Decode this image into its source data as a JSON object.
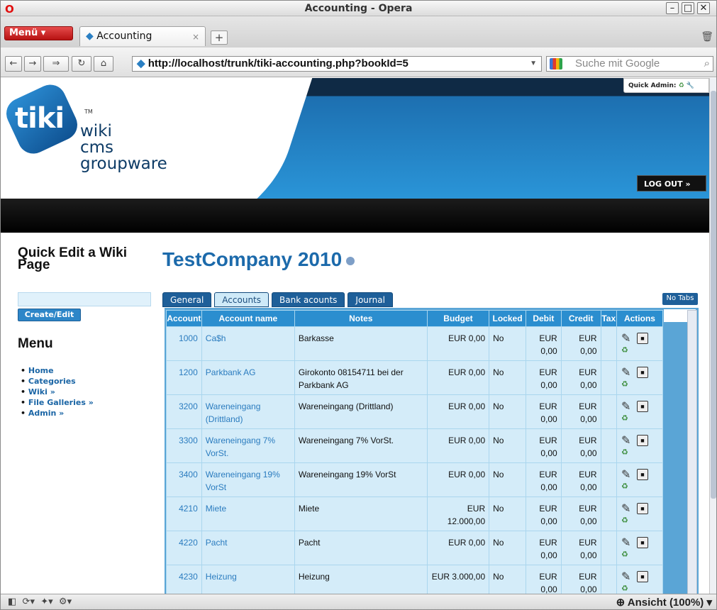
{
  "window": {
    "title": "Accounting - Opera"
  },
  "browser": {
    "menu_label": "Menü",
    "tab_title": "Accounting",
    "tab_close": "×",
    "new_tab": "+",
    "url": "http://localhost/trunk/tiki-accounting.php?bookId=5",
    "search_placeholder": "Suche mit Google"
  },
  "header": {
    "logo_main": "tiki",
    "logo_tm": "TM",
    "logo_sub1": "wiki",
    "logo_sub2": "cms",
    "logo_sub3": "groupware",
    "quick_admin": "Quick Admin:",
    "logout": "LOG OUT »"
  },
  "sidebar": {
    "quick_edit_title": "Quick Edit a Wiki Page",
    "create_button": "Create/Edit",
    "menu_title": "Menu",
    "menu_items": [
      "Home",
      "Categories",
      "Wiki »",
      "File Galleries »",
      "Admin »"
    ]
  },
  "main": {
    "title": "TestCompany 2010",
    "tabs": [
      "General",
      "Accounts",
      "Bank acounts",
      "Journal"
    ],
    "active_tab": "Accounts",
    "no_tabs": "No Tabs",
    "columns": [
      "Account",
      "Account name",
      "Notes",
      "Budget",
      "Locked",
      "Debit",
      "Credit",
      "Tax",
      "Actions"
    ],
    "rows": [
      {
        "account": "1000",
        "name": "Ca$h",
        "notes": "Barkasse",
        "budget": "EUR 0,00",
        "locked": "No",
        "debit": "EUR 0,00",
        "credit": "EUR 0,00"
      },
      {
        "account": "1200",
        "name": "Parkbank AG",
        "notes": "Girokonto 08154711 bei der Parkbank AG",
        "budget": "EUR 0,00",
        "locked": "No",
        "debit": "EUR 0,00",
        "credit": "EUR 0,00"
      },
      {
        "account": "3200",
        "name": "Wareneingang (Drittland)",
        "notes": "Wareneingang (Drittland)",
        "budget": "EUR 0,00",
        "locked": "No",
        "debit": "EUR 0,00",
        "credit": "EUR 0,00"
      },
      {
        "account": "3300",
        "name": "Wareneingang 7% VorSt.",
        "notes": "Wareneingang 7% VorSt.",
        "budget": "EUR 0,00",
        "locked": "No",
        "debit": "EUR 0,00",
        "credit": "EUR 0,00"
      },
      {
        "account": "3400",
        "name": "Wareneingang 19% VorSt",
        "notes": "Wareneingang 19% VorSt",
        "budget": "EUR 0,00",
        "locked": "No",
        "debit": "EUR 0,00",
        "credit": "EUR 0,00"
      },
      {
        "account": "4210",
        "name": "Miete",
        "notes": "Miete",
        "budget": "EUR 12.000,00",
        "locked": "No",
        "debit": "EUR 0,00",
        "credit": "EUR 0,00"
      },
      {
        "account": "4220",
        "name": "Pacht",
        "notes": "Pacht",
        "budget": "EUR 0,00",
        "locked": "No",
        "debit": "EUR 0,00",
        "credit": "EUR 0,00"
      },
      {
        "account": "4230",
        "name": "Heizung",
        "notes": "Heizung",
        "budget": "EUR 3.000,00",
        "locked": "No",
        "debit": "EUR 0,00",
        "credit": "EUR 0,00"
      }
    ]
  },
  "statusbar": {
    "zoom": "Ansicht (100%)"
  }
}
